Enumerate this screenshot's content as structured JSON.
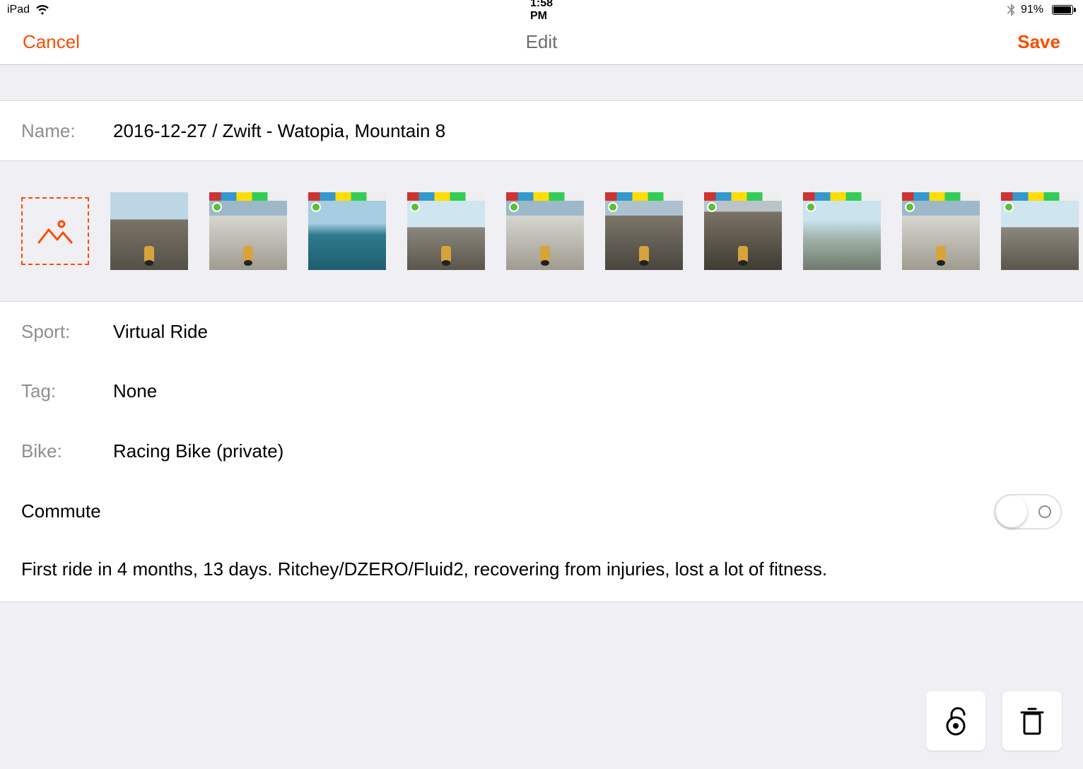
{
  "status_bar": {
    "device": "iPad",
    "time": "1:58 PM",
    "battery_percent": "91%",
    "battery_fill_pct": 91
  },
  "nav": {
    "cancel": "Cancel",
    "title": "Edit",
    "save": "Save"
  },
  "fields": {
    "name_label": "Name:",
    "name_value": "2016-12-27 / Zwift - Watopia, Mountain 8",
    "sport_label": "Sport:",
    "sport_value": "Virtual Ride",
    "tag_label": "Tag:",
    "tag_value": "None",
    "bike_label": "Bike:",
    "bike_value": "Racing Bike (private)",
    "commute_label": "Commute",
    "commute_on": false,
    "description": "First ride in 4 months, 13 days. Ritchey/DZERO/Fluid2, recovering from injuries, lost a lot of fitness."
  },
  "photos": {
    "count": 10,
    "add_label": "Add photo"
  },
  "colors": {
    "accent": "#fc4c02",
    "label_gray": "#8e8e93",
    "separator": "#d9d8dc"
  },
  "bottom": {
    "privacy_button": "privacy",
    "delete_button": "delete"
  }
}
